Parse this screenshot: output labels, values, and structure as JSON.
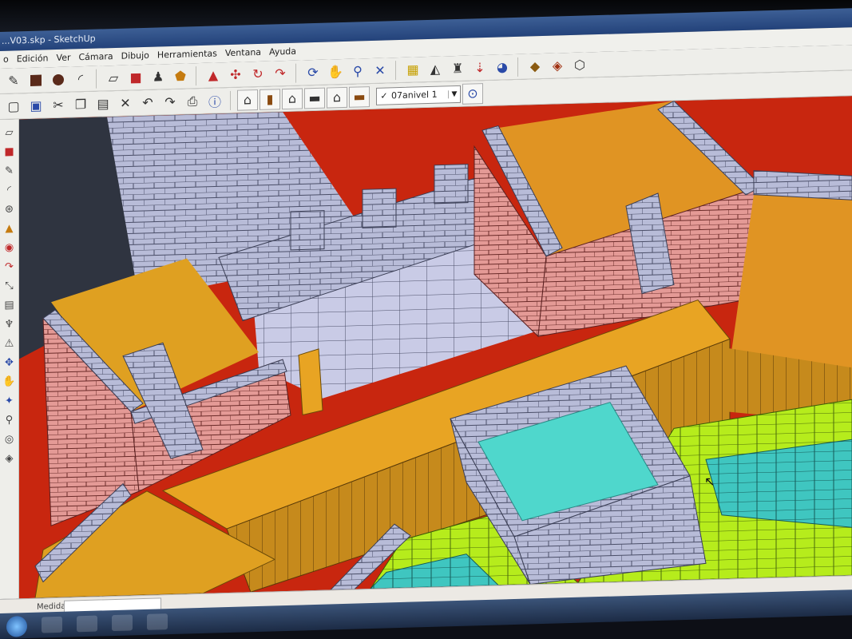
{
  "window": {
    "title": "...V03.skp - SketchUp"
  },
  "menu": [
    "o",
    "Edición",
    "Ver",
    "Cámara",
    "Dibujo",
    "Herramientas",
    "Ventana",
    "Ayuda"
  ],
  "toolbar_top": {
    "icons": [
      "pencil-icon",
      "rectangle-icon",
      "circle-icon",
      "arc-icon",
      "eraser-icon",
      "paint-bucket-icon",
      "push-pull-icon",
      "follow-me-icon",
      "move-icon",
      "rotate-icon",
      "offset-icon",
      "orbit-icon",
      "pan-icon",
      "zoom-icon",
      "zoom-extents-icon",
      "tape-measure-icon",
      "protractor-icon",
      "axes-icon",
      "section-plane-icon",
      "component-icon",
      "make-group-icon",
      "warehouse-icon"
    ]
  },
  "toolbar_second": {
    "icons": [
      "new-icon",
      "save-icon",
      "cut-icon",
      "copy-icon",
      "paste-icon",
      "delete-icon",
      "undo-icon",
      "redo-icon",
      "print-icon",
      "info-icon",
      "iso-view-icon",
      "front-view-icon",
      "top-view-icon",
      "right-view-icon",
      "back-view-icon",
      "left-view-icon"
    ],
    "layer_selected": "07anivel 1"
  },
  "left_toolbar": {
    "icons": [
      "select-icon",
      "eraser-icon",
      "pencil-icon",
      "arc-icon",
      "orbit-icon",
      "push-pull-icon",
      "follow-me-icon",
      "rotate-icon",
      "dimension-icon",
      "text-icon",
      "axes-icon",
      "tape-icon",
      "move-icon",
      "scale-icon",
      "pan-icon",
      "zoom-icon",
      "walk-icon",
      "look-around-icon"
    ]
  },
  "status": {
    "measure_label": "Medidas"
  },
  "colors": {
    "background": "#c8260f",
    "stone": "#b8bcd8",
    "brick": "#e49a96",
    "sand": "#e8a423",
    "water": "#4fd7cc",
    "grass": "#b6ec1c"
  }
}
